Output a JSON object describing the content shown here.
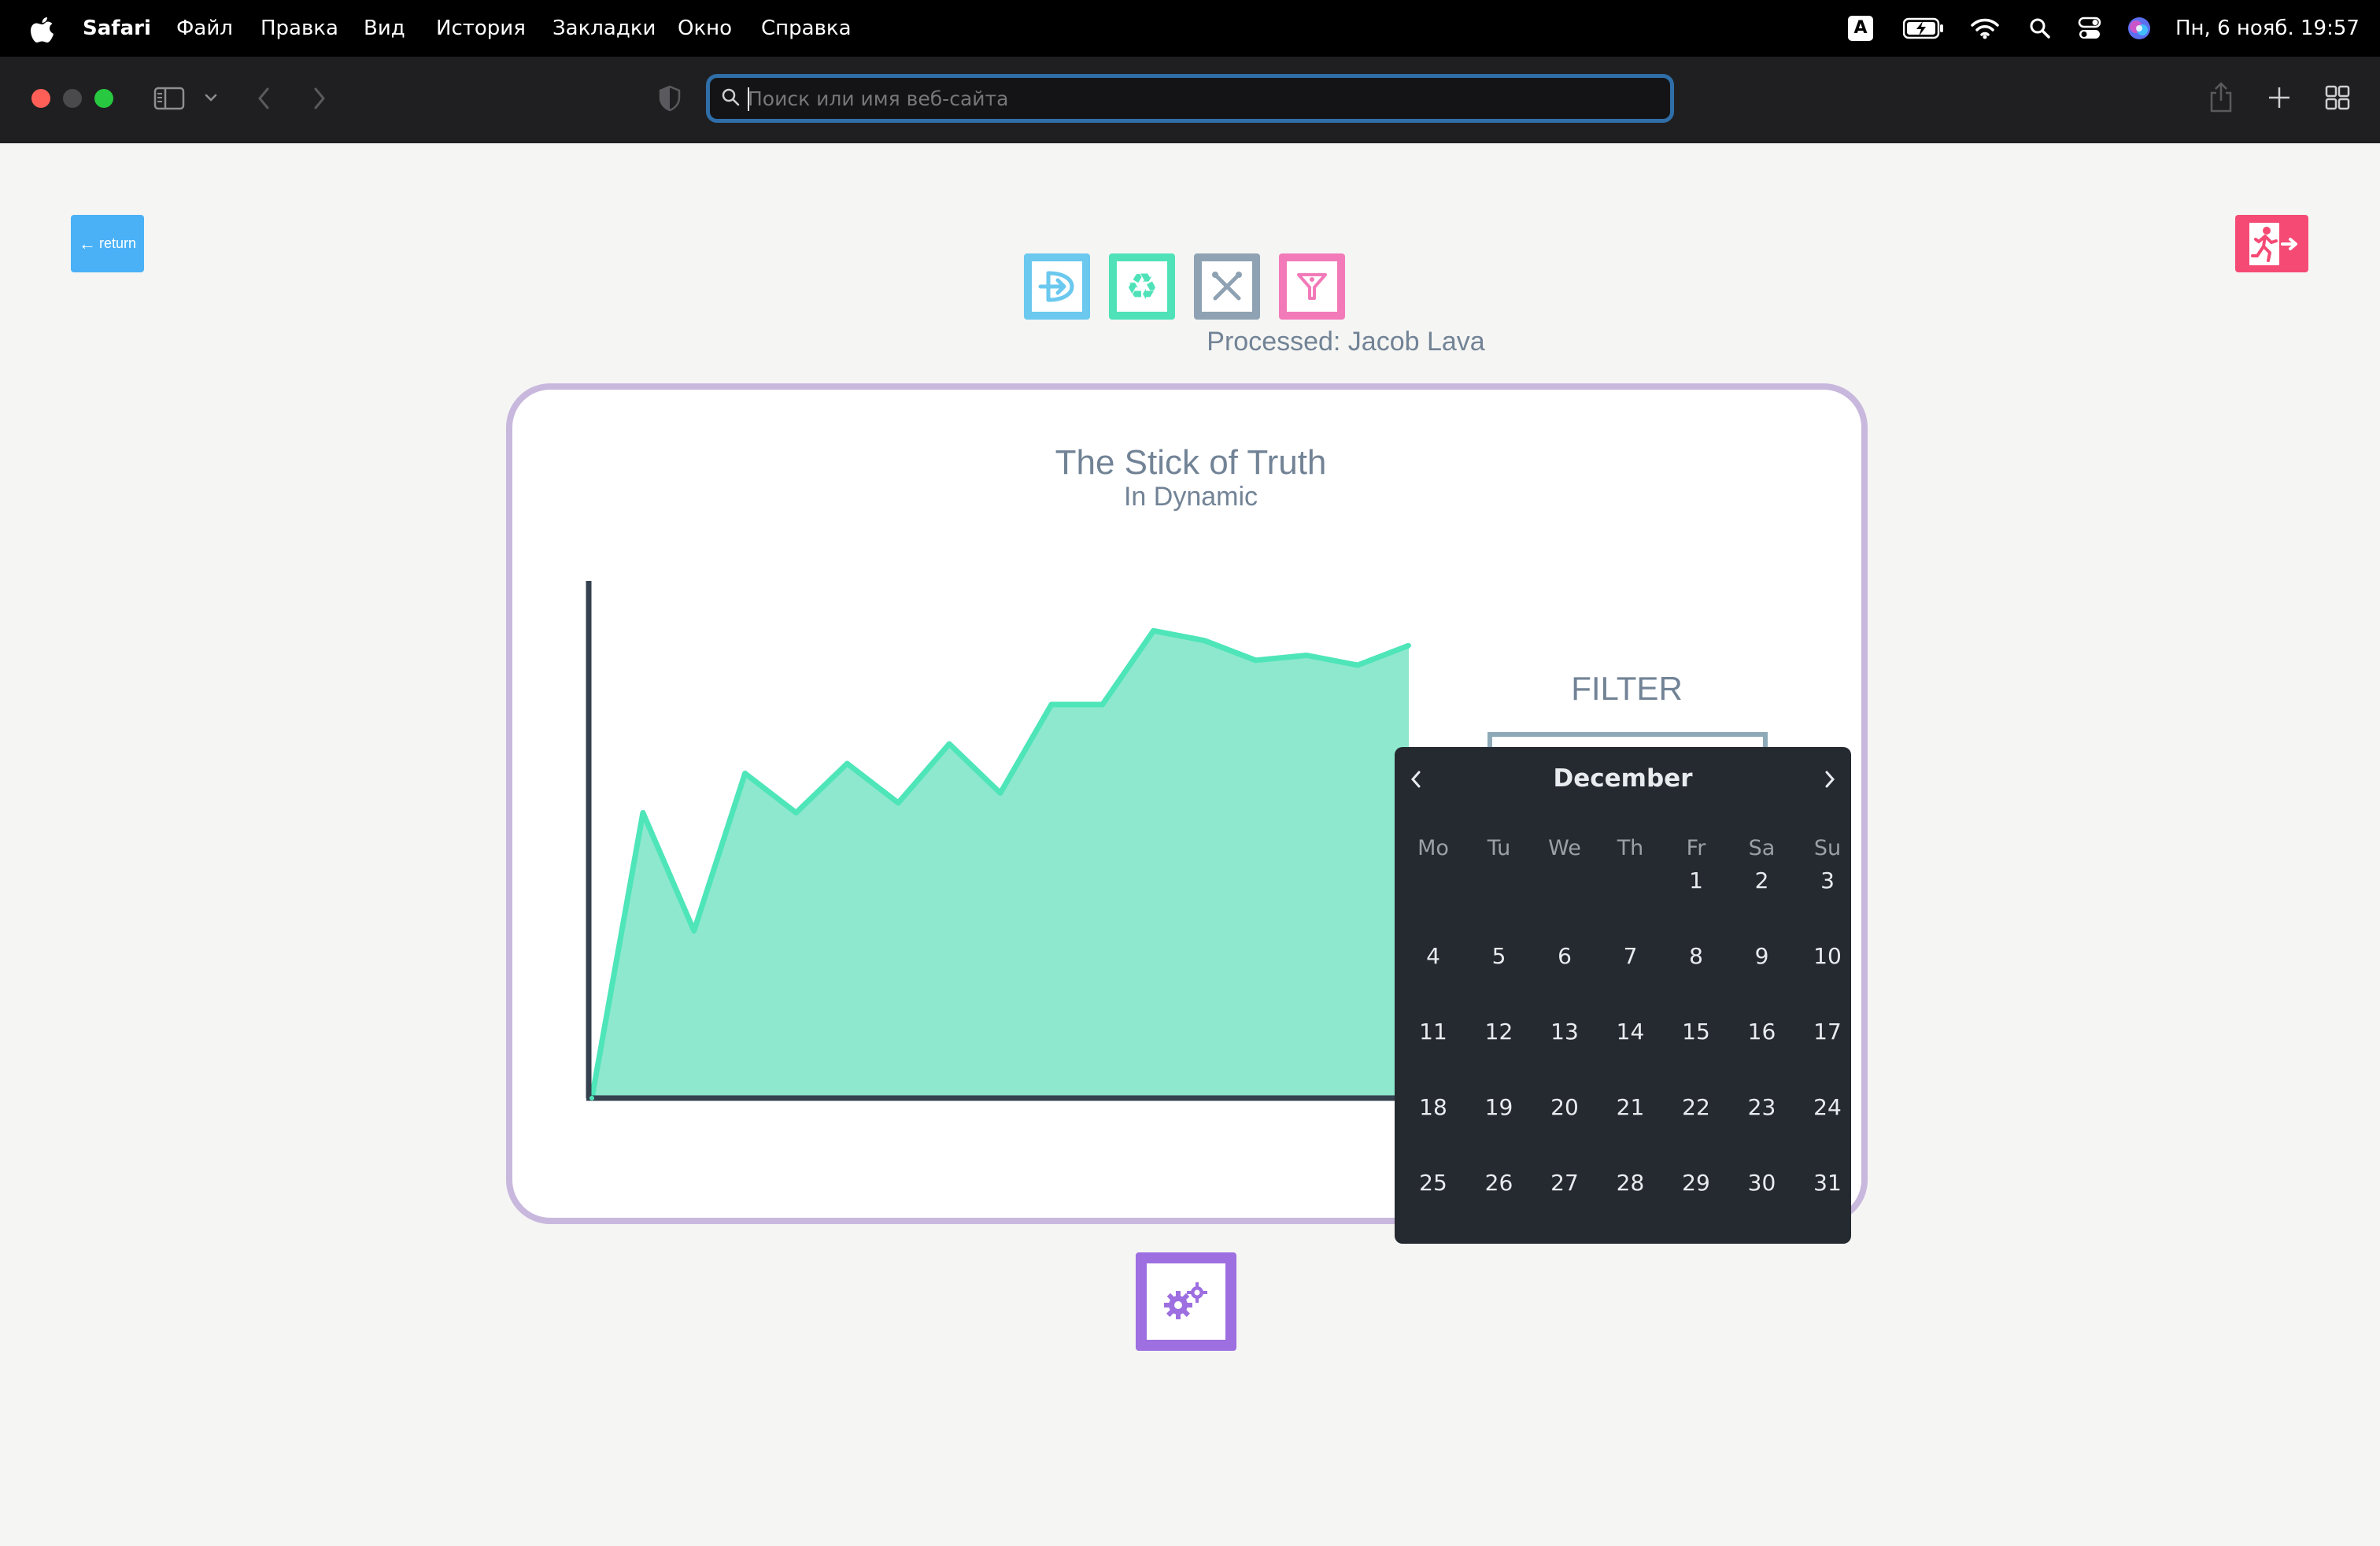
{
  "menubar": {
    "app_name": "Safari",
    "items": [
      "Файл",
      "Правка",
      "Вид",
      "История",
      "Закладки",
      "Окно",
      "Справка"
    ],
    "input_indicator": "A",
    "datetime": "Пн, 6 нояб. 19:57"
  },
  "browser": {
    "address_placeholder": "Поиск или имя веб-сайта",
    "address_value": ""
  },
  "page": {
    "return_label": "return",
    "processed_text": "Processed: Jacob Lava",
    "filter_label": "FILTER",
    "colors": {
      "return": "#4ab1f7",
      "exit": "#f54a74",
      "tool_blue": "#6bc8ef",
      "tool_green": "#4fe2b8",
      "tool_gray": "#8ea2b3",
      "tool_pink": "#f27ab9",
      "settings": "#9d6fe0",
      "card_border": "#c9b8dd",
      "area_fill": "#8ee8cd",
      "area_line": "#4ee5b9"
    }
  },
  "chart_data": {
    "type": "area",
    "title": "The Stick of Truth",
    "subtitle": "In Dynamic",
    "x": [
      0,
      1,
      2,
      3,
      4,
      5,
      6,
      7,
      8,
      9,
      10,
      11,
      12,
      13,
      14,
      15,
      16
    ],
    "values": [
      0,
      58,
      34,
      66,
      58,
      68,
      60,
      72,
      62,
      80,
      80,
      95,
      93,
      89,
      90,
      88,
      92
    ],
    "ylim": [
      0,
      100
    ],
    "grid": false,
    "xlabel": "",
    "ylabel": ""
  },
  "datepicker": {
    "month": "December",
    "weekdays": [
      "Mo",
      "Tu",
      "We",
      "Th",
      "Fr",
      "Sa",
      "Su"
    ],
    "first_weekday_index": 4,
    "days": [
      1,
      2,
      3,
      4,
      5,
      6,
      7,
      8,
      9,
      10,
      11,
      12,
      13,
      14,
      15,
      16,
      17,
      18,
      19,
      20,
      21,
      22,
      23,
      24,
      25,
      26,
      27,
      28,
      29,
      30,
      31
    ]
  }
}
